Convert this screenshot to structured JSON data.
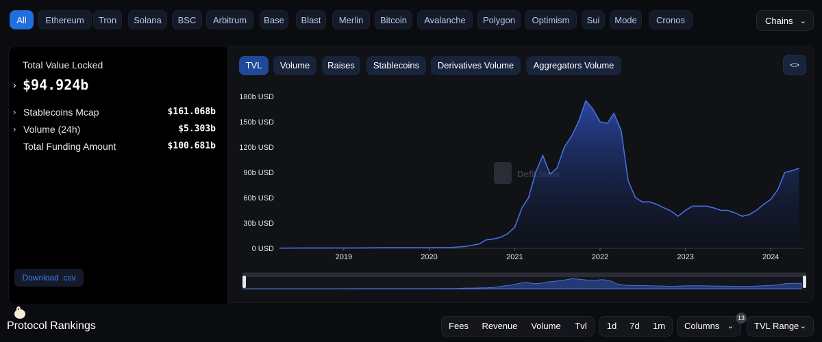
{
  "chains": [
    "All",
    "Ethereum",
    "Tron",
    "Solana",
    "BSC",
    "Arbitrum",
    "Base",
    "Blast",
    "Merlin",
    "Bitcoin",
    "Avalanche",
    "Polygon",
    "Optimism",
    "Sui",
    "Mode",
    "Cronos"
  ],
  "chains_dropdown": "Chains",
  "stats": {
    "tvl_label": "Total Value Locked",
    "tvl_value": "$94.924b",
    "rows": [
      {
        "label": "Stablecoins Mcap",
        "value": "$161.068b"
      },
      {
        "label": "Volume (24h)",
        "value": "$5.303b"
      },
      {
        "label": "Total Funding Amount",
        "value": "$100.681b"
      }
    ],
    "download": "Download .csv"
  },
  "tabs": [
    "TVL",
    "Volume",
    "Raises",
    "Stablecoins",
    "Derivatives Volume",
    "Aggregators Volume"
  ],
  "embed_icon": "code-icon",
  "watermark": "DefiLlama",
  "bottom": {
    "title": "Protocol Rankings",
    "metrics": [
      "Fees",
      "Revenue",
      "Volume",
      "Tvl"
    ],
    "periods": [
      "1d",
      "7d",
      "1m"
    ],
    "columns": "Columns",
    "columns_badge": "13",
    "range": "TVL Range"
  },
  "colors": {
    "accent": "#1f6fde",
    "line": "#4a6ee0",
    "background": "#0b0c0f"
  },
  "chart_data": {
    "type": "area",
    "series": [
      {
        "name": "TVL",
        "x": [
          "2018-04",
          "2018-07",
          "2018-10",
          "2019-01",
          "2019-04",
          "2019-07",
          "2019-10",
          "2020-01",
          "2020-04",
          "2020-06",
          "2020-08",
          "2020-09",
          "2020-10",
          "2020-11",
          "2020-12",
          "2021-01",
          "2021-02",
          "2021-03",
          "2021-04",
          "2021-05",
          "2021-06",
          "2021-07",
          "2021-08",
          "2021-09",
          "2021-10",
          "2021-11",
          "2021-12",
          "2022-01",
          "2022-02",
          "2022-03",
          "2022-04",
          "2022-05",
          "2022-06",
          "2022-07",
          "2022-08",
          "2022-09",
          "2022-10",
          "2022-11",
          "2022-12",
          "2023-01",
          "2023-02",
          "2023-03",
          "2023-04",
          "2023-05",
          "2023-06",
          "2023-07",
          "2023-08",
          "2023-09",
          "2023-10",
          "2023-11",
          "2023-12",
          "2024-01",
          "2024-02",
          "2024-03",
          "2024-04",
          "2024-05"
        ],
        "values": [
          0.2,
          0.3,
          0.3,
          0.3,
          0.5,
          0.7,
          0.7,
          0.8,
          1.0,
          2.0,
          5.0,
          10.0,
          11.0,
          13.0,
          17.0,
          25.0,
          48.0,
          60.0,
          90.0,
          110.0,
          88.0,
          95.0,
          120.0,
          133.0,
          150.0,
          175.0,
          165.0,
          150.0,
          148.0,
          160.0,
          140.0,
          80.0,
          60.0,
          55.0,
          55.0,
          52.0,
          48.0,
          44.0,
          38.0,
          45.0,
          50.0,
          50.0,
          50.0,
          48.0,
          45.0,
          45.0,
          42.0,
          38.0,
          40.0,
          45.0,
          52.0,
          58.0,
          70.0,
          90.0,
          92.0,
          94.9
        ]
      }
    ],
    "x_ticks": [
      "2019",
      "2020",
      "2021",
      "2022",
      "2023",
      "2024"
    ],
    "y_ticks": [
      "0 USD",
      "30b USD",
      "60b USD",
      "90b USD",
      "120b USD",
      "150b USD",
      "180b USD"
    ],
    "ylim": [
      0,
      180
    ],
    "grid": false
  }
}
